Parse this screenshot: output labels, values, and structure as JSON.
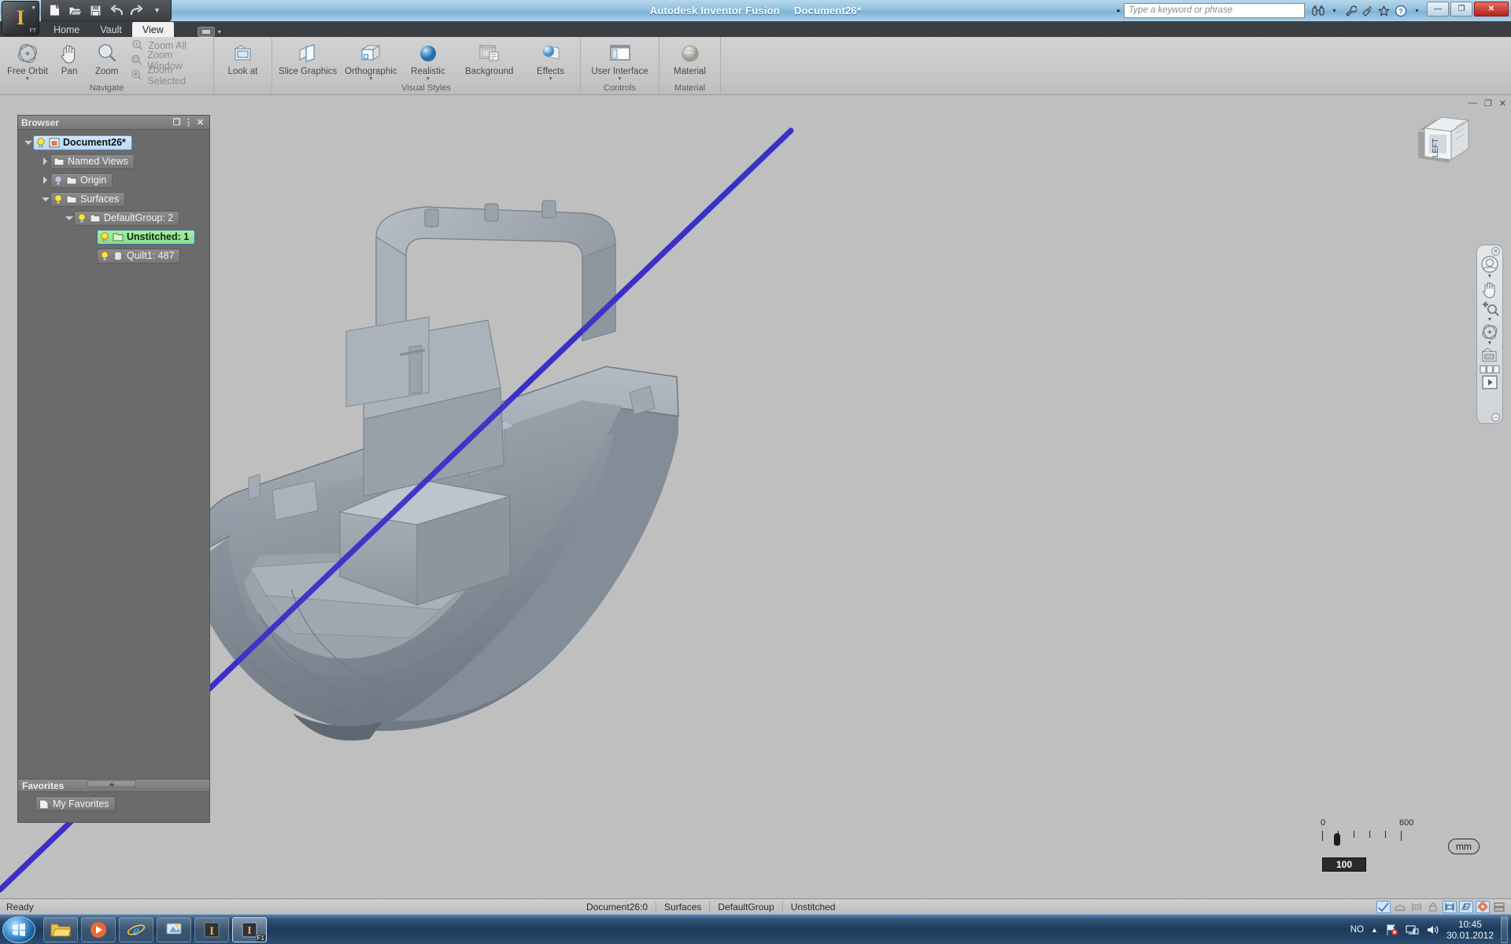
{
  "window": {
    "app_title": "Autodesk Inventor Fusion",
    "document_title": "Document26*",
    "minimize": "—",
    "restore": "❐",
    "close": "✕",
    "doc_minimize": "—",
    "doc_restore": "❐",
    "doc_close": "✕"
  },
  "quick_access": {
    "new": "new-icon",
    "open": "open-icon",
    "save": "save-icon",
    "undo": "undo-icon",
    "redo": "redo-icon",
    "more": "▼"
  },
  "search": {
    "placeholder": "Type a keyword or phrase",
    "value": "",
    "arrow": "▸",
    "icons": [
      "binoculars-icon",
      "wrench-icon",
      "satellite-icon",
      "star-icon",
      "help-icon"
    ]
  },
  "tabs": [
    {
      "label": "Home",
      "active": false
    },
    {
      "label": "Vault",
      "active": false
    },
    {
      "label": "View",
      "active": true
    }
  ],
  "ribbon": {
    "panels": [
      {
        "title": "Navigate",
        "large": [
          {
            "label": "Free Orbit",
            "icon": "free-orbit-icon",
            "dropdown": true
          },
          {
            "label": "Pan",
            "icon": "pan-hand-icon",
            "dropdown": false
          },
          {
            "label": "Zoom",
            "icon": "zoom-magnifier-icon",
            "dropdown": false
          }
        ],
        "small": [
          {
            "label": "Zoom All",
            "icon": "zoom-all-icon"
          },
          {
            "label": "Zoom Window",
            "icon": "zoom-window-icon"
          },
          {
            "label": "Zoom Selected",
            "icon": "zoom-selected-icon"
          }
        ]
      },
      {
        "title": "",
        "large": [
          {
            "label": "Look at",
            "icon": "look-at-icon",
            "dropdown": false
          }
        ],
        "small": []
      },
      {
        "title": "Visual Styles",
        "large": [
          {
            "label": "Slice Graphics",
            "icon": "slice-graphics-icon",
            "dropdown": false
          },
          {
            "label": "Orthographic",
            "icon": "orthographic-cube-icon",
            "dropdown": true
          },
          {
            "label": "Realistic",
            "icon": "realistic-sphere-icon",
            "dropdown": true
          },
          {
            "label": "Background",
            "icon": "background-icon",
            "dropdown": false
          },
          {
            "label": "Effects",
            "icon": "effects-icon",
            "dropdown": true
          }
        ],
        "small": []
      },
      {
        "title": "Controls",
        "large": [
          {
            "label": "User Interface",
            "icon": "user-interface-icon",
            "dropdown": true
          }
        ],
        "small": []
      },
      {
        "title": "Material",
        "large": [
          {
            "label": "Material",
            "icon": "material-sphere-icon",
            "dropdown": false
          }
        ],
        "small": []
      }
    ]
  },
  "browser": {
    "title": "Browser",
    "buttons": {
      "dock": "❐",
      "menu": "⋮",
      "close": "✕"
    },
    "tree": [
      {
        "label": "Document26*",
        "indent": 0,
        "expander": "down",
        "bulb": "on",
        "icon": "document-icon",
        "state": "selected"
      },
      {
        "label": "Named Views",
        "indent": 1,
        "expander": "right",
        "bulb": "none",
        "icon": "folder-icon",
        "state": "normal"
      },
      {
        "label": "Origin",
        "indent": 1,
        "expander": "right",
        "bulb": "off",
        "icon": "folder-icon",
        "state": "normal"
      },
      {
        "label": "Surfaces",
        "indent": 1,
        "expander": "down",
        "bulb": "on",
        "icon": "folder-icon",
        "state": "normal"
      },
      {
        "label": "DefaultGroup: 2",
        "indent": 2,
        "expander": "down",
        "bulb": "on",
        "icon": "folder-icon",
        "state": "normal"
      },
      {
        "label": "Unstitched: 1",
        "indent": 3,
        "expander": "none",
        "bulb": "on",
        "icon": "folder-icon",
        "state": "highlighted"
      },
      {
        "label": "Quilt1: 487",
        "indent": 3,
        "expander": "none",
        "bulb": "on",
        "icon": "quilt-icon",
        "state": "normal"
      }
    ]
  },
  "favorites": {
    "title": "Favorites",
    "items": [
      {
        "label": "My Favorites",
        "icon": "favorites-page-icon"
      }
    ]
  },
  "viewcube": {
    "face_label": "LEFT"
  },
  "navbar": {
    "items": [
      {
        "name": "steering-wheel-icon",
        "dropdown": true
      },
      {
        "name": "pan-hand-icon",
        "dropdown": false
      },
      {
        "name": "zoom-icon",
        "dropdown": true
      },
      {
        "name": "orbit-icon",
        "dropdown": true
      },
      {
        "name": "look-at-icon",
        "dropdown": false
      },
      {
        "name": "window-layout-icon",
        "dropdown": false
      },
      {
        "name": "play-animation-icon",
        "dropdown": false
      }
    ],
    "close": "✕",
    "minimize": "–"
  },
  "scale_widget": {
    "min_label": "0",
    "max_label": "600",
    "unit": "mm",
    "value": "100",
    "tick_count": 7
  },
  "status_bar": {
    "ready": "Ready",
    "breadcrumbs": [
      "Document26:0",
      "Surfaces",
      "DefaultGroup",
      "Unstitched"
    ],
    "icons": [
      {
        "name": "check-select-icon",
        "active": true
      },
      {
        "name": "dome-icon",
        "active": false
      },
      {
        "name": "measure-icon",
        "active": false
      },
      {
        "name": "lock-icon",
        "active": false
      },
      {
        "name": "frame-icon",
        "active": true
      },
      {
        "name": "grid-icon",
        "active": true
      },
      {
        "name": "orbit-red-icon",
        "active": true
      },
      {
        "name": "panels-icon",
        "active": false
      }
    ]
  },
  "taskbar": {
    "start": "start-orb",
    "items": [
      {
        "name": "explorer-icon"
      },
      {
        "name": "media-player-icon"
      },
      {
        "name": "internet-explorer-icon"
      },
      {
        "name": "paint-icon"
      },
      {
        "name": "inventor-icon"
      },
      {
        "name": "inventor-fusion-icon",
        "badge": "F1"
      }
    ],
    "tray": {
      "locale": "NO",
      "expand": "▲",
      "icons": [
        "flag-alert-icon",
        "network-icon",
        "volume-icon"
      ],
      "time": "10:45",
      "date": "30.01.2012"
    }
  },
  "colors": {
    "title_blue": "#8fc0e0",
    "viewport_gray": "#bfbfbf",
    "model_gray": "#8e98a3",
    "line_blue": "#3a30c8",
    "highlight_green": "#8ddd86",
    "selection_blue": "#b9d9f7",
    "taskbar_blue": "#1d3a59"
  }
}
